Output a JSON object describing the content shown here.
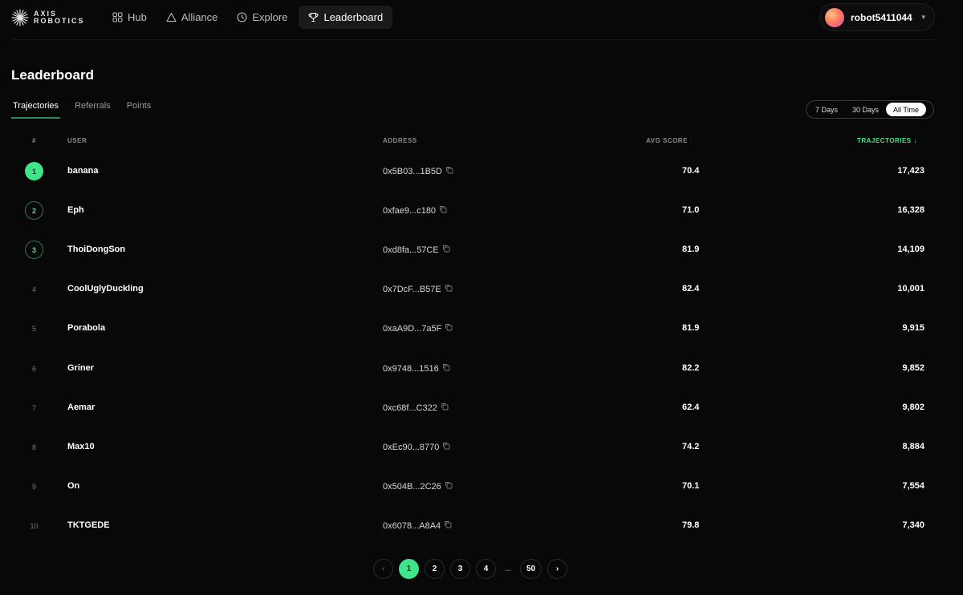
{
  "brand": {
    "line1": "AXIS",
    "line2": "ROBOTICS"
  },
  "nav": {
    "items": [
      {
        "label": "Hub",
        "icon": "grid-icon"
      },
      {
        "label": "Alliance",
        "icon": "triangle-icon"
      },
      {
        "label": "Explore",
        "icon": "compass-icon"
      },
      {
        "label": "Leaderboard",
        "icon": "trophy-icon",
        "active": true
      }
    ]
  },
  "user": {
    "name": "robot5411044"
  },
  "page": {
    "title": "Leaderboard"
  },
  "tabs": [
    "Trajectories",
    "Referrals",
    "Points"
  ],
  "range": [
    "7 Days",
    "30 Days",
    "All Time"
  ],
  "columns": {
    "rank": "#",
    "user": "USER",
    "address": "ADDRESS",
    "avg_score": "AVG SCORE",
    "avg_score_sort": "↓",
    "trajectories": "TRAJECTORIES ↓"
  },
  "rows": [
    {
      "rank": "1",
      "user": "banana",
      "address": "0x5B03...1B5D",
      "score": "70.4",
      "traj": "17,423"
    },
    {
      "rank": "2",
      "user": "Eph",
      "address": "0xfae9...c180",
      "score": "71.0",
      "traj": "16,328"
    },
    {
      "rank": "3",
      "user": "ThoiDongSon",
      "address": "0xd8fa...57CE",
      "score": "81.9",
      "traj": "14,109"
    },
    {
      "rank": "4",
      "user": "CoolUglyDuckling",
      "address": "0x7DcF...B57E",
      "score": "82.4",
      "traj": "10,001"
    },
    {
      "rank": "5",
      "user": "Porabola",
      "address": "0xaA9D...7a5F",
      "score": "81.9",
      "traj": "9,915"
    },
    {
      "rank": "6",
      "user": "Griner",
      "address": "0x9748...1516",
      "score": "82.2",
      "traj": "9,852"
    },
    {
      "rank": "7",
      "user": "Aemar",
      "address": "0xc68f...C322",
      "score": "62.4",
      "traj": "9,802"
    },
    {
      "rank": "8",
      "user": "Max10",
      "address": "0xEc90...8770",
      "score": "74.2",
      "traj": "8,884"
    },
    {
      "rank": "9",
      "user": "On",
      "address": "0x504B...2C26",
      "score": "70.1",
      "traj": "7,554"
    },
    {
      "rank": "10",
      "user": "TKTGEDE",
      "address": "0x6078...A8A4",
      "score": "79.8",
      "traj": "7,340"
    }
  ],
  "pagination": {
    "prev": "‹",
    "pages": [
      "1",
      "2",
      "3",
      "4"
    ],
    "ellipsis": "...",
    "last": "50",
    "next": "›",
    "current": "1"
  },
  "colors": {
    "accent": "#3ee58a",
    "background": "#080808"
  }
}
